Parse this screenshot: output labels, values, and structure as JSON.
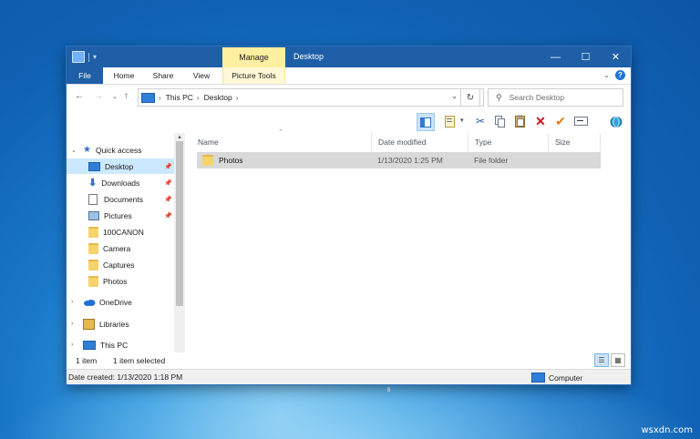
{
  "window": {
    "title": "Desktop",
    "contextual_tab": "Manage",
    "caption": {
      "minimize": "—",
      "maximize": "☐",
      "close": "✕"
    }
  },
  "ribbon": {
    "tabs": [
      "File",
      "Home",
      "Share",
      "View",
      "Picture Tools"
    ],
    "help": "?"
  },
  "address": {
    "crumbs": [
      "This PC",
      "Desktop"
    ],
    "search_placeholder": "Search Desktop"
  },
  "nav_pane": {
    "items": [
      {
        "label": "Quick access"
      },
      {
        "label": "Desktop"
      },
      {
        "label": "Downloads"
      },
      {
        "label": "Documents"
      },
      {
        "label": "Pictures"
      },
      {
        "label": "100CANON"
      },
      {
        "label": "Camera"
      },
      {
        "label": "Captures"
      },
      {
        "label": "Photos"
      },
      {
        "label": "OneDrive"
      },
      {
        "label": "Libraries"
      },
      {
        "label": "This PC"
      }
    ]
  },
  "columns": [
    "Name",
    "Date modified",
    "Type",
    "Size"
  ],
  "files": [
    {
      "name": "Photos",
      "date": "1/13/2020 1:25 PM",
      "type": "File folder",
      "size": ""
    }
  ],
  "status": {
    "count": "1 item",
    "selected": "1 item selected",
    "date_created": "Date created: 1/13/2020 1:18 PM",
    "location": "Computer"
  },
  "watermark": "wsxdn.com",
  "colors": {
    "accent": "#1e5fa8",
    "manage_tab": "#ffefa0",
    "selection": "#cce8ff"
  }
}
